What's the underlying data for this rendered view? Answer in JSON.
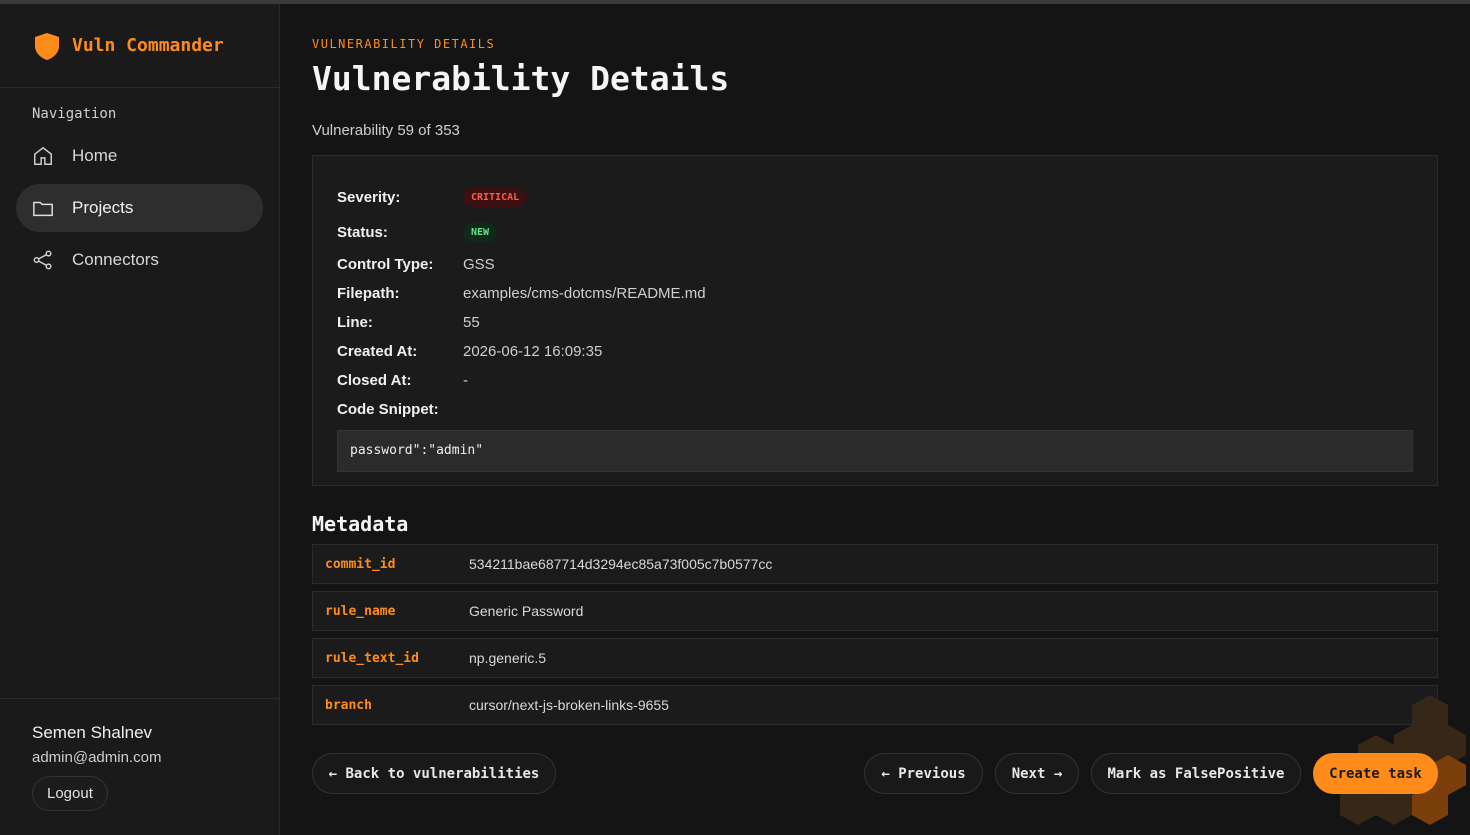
{
  "app": {
    "name": "Vuln Commander"
  },
  "sidebar": {
    "nav_title": "Navigation",
    "items": [
      {
        "label": "Home",
        "icon": "home-icon",
        "active": false
      },
      {
        "label": "Projects",
        "icon": "folder-icon",
        "active": true
      },
      {
        "label": "Connectors",
        "icon": "share-icon",
        "active": false
      }
    ],
    "user": {
      "name": "Semen Shalnev",
      "email": "admin@admin.com",
      "logout_label": "Logout"
    }
  },
  "header": {
    "eyebrow": "VULNERABILITY DETAILS",
    "title": "Vulnerability Details",
    "counter": "Vulnerability 59 of 353"
  },
  "details": {
    "severity_label": "Severity:",
    "severity_value": "CRITICAL",
    "status_label": "Status:",
    "status_value": "NEW",
    "control_type_label": "Control Type:",
    "control_type_value": "GSS",
    "filepath_label": "Filepath:",
    "filepath_value": "examples/cms-dotcms/README.md",
    "line_label": "Line:",
    "line_value": "55",
    "created_label": "Created At:",
    "created_value": "2026-06-12 16:09:35",
    "closed_label": "Closed At:",
    "closed_value": "-",
    "snippet_label": "Code Snippet:",
    "snippet_value": "password\":\"admin\""
  },
  "metadata": {
    "title": "Metadata",
    "rows": [
      {
        "key": "commit_id",
        "value": "534211bae687714d3294ec85a73f005c7b0577cc"
      },
      {
        "key": "rule_name",
        "value": "Generic Password"
      },
      {
        "key": "rule_text_id",
        "value": "np.generic.5"
      },
      {
        "key": "branch",
        "value": "cursor/next-js-broken-links-9655"
      }
    ]
  },
  "actions": {
    "back_label": "← Back to vulnerabilities",
    "previous_label": "← Previous",
    "next_label": "Next →",
    "false_positive_label": "Mark as FalsePositive",
    "create_task_label": "Create task"
  },
  "colors": {
    "accent": "#ff8c1a",
    "critical": "#ff5a4a",
    "new": "#6fe08a",
    "background": "#141414"
  }
}
